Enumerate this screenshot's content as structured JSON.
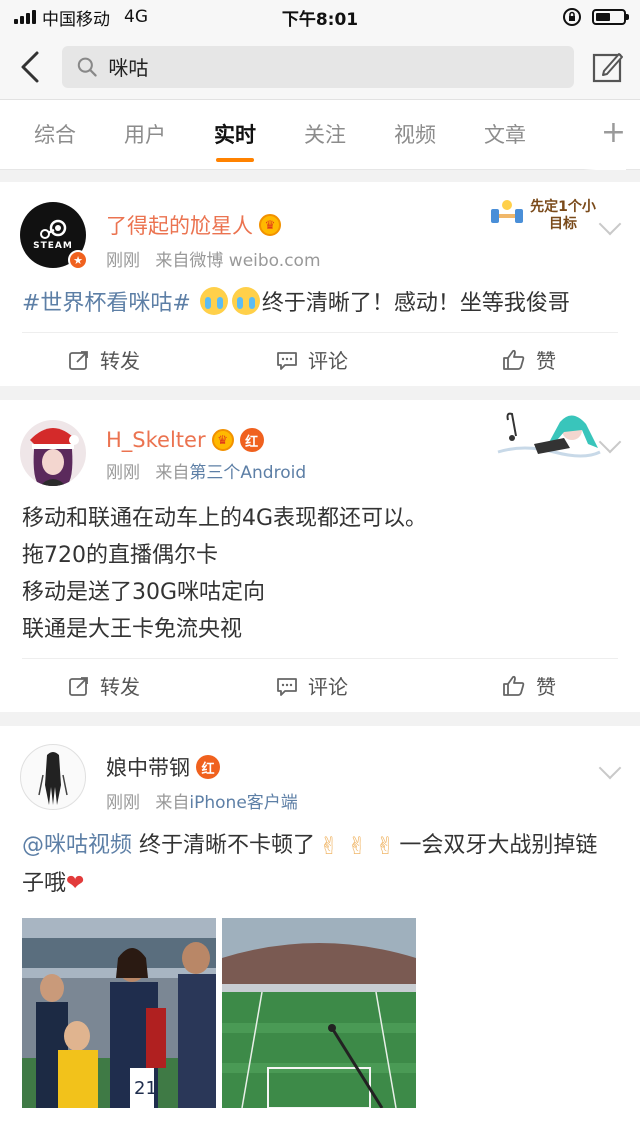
{
  "status": {
    "carrier": "中国移动",
    "network": "4G",
    "time": "下午8:01",
    "battery_level": 0.55
  },
  "header": {
    "search_value": "咪咕"
  },
  "tabs": [
    {
      "label": "综合",
      "active": false
    },
    {
      "label": "用户",
      "active": false
    },
    {
      "label": "实时",
      "active": true
    },
    {
      "label": "关注",
      "active": false
    },
    {
      "label": "视频",
      "active": false
    },
    {
      "label": "文章",
      "active": false
    }
  ],
  "tab_more": "+",
  "accent_color": "#ff8200",
  "posts": [
    {
      "name": "了得起的尬星人",
      "time": "刚刚",
      "source_prefix": "来自微博 weibo.com",
      "source_link": "",
      "avatar_text": "STEAM",
      "sticker_text": "先定1个小目标",
      "text": {
        "tag": "#世界杯看咪咕#",
        "body": "终于清晰了！感动！坐等我俊哥"
      },
      "actions": {
        "repost": "转发",
        "comment": "评论",
        "like": "赞"
      }
    },
    {
      "name": "H_Skelter",
      "time": "刚刚",
      "source_prefix": "来自",
      "source_link": "第三个Android",
      "lines": [
        "移动和联通在动车上的4G表现都还可以。",
        "拖720的直播偶尔卡",
        "移动是送了30G咪咕定向",
        "联通是大王卡免流央视"
      ],
      "actions": {
        "repost": "转发",
        "comment": "评论",
        "like": "赞"
      }
    },
    {
      "name": "娘中带钢",
      "time": "刚刚",
      "source_prefix": "来自",
      "source_link": "iPhone客户端",
      "text": {
        "mention": "@咪咕视频",
        "body1": "终于清晰不卡顿了",
        "body2": "一会双牙大战别掉链子哦",
        "heart": "❤"
      },
      "badge": "红",
      "photo1_number": "21"
    }
  ],
  "badge_hong": "红",
  "crown_glyph": "♛"
}
